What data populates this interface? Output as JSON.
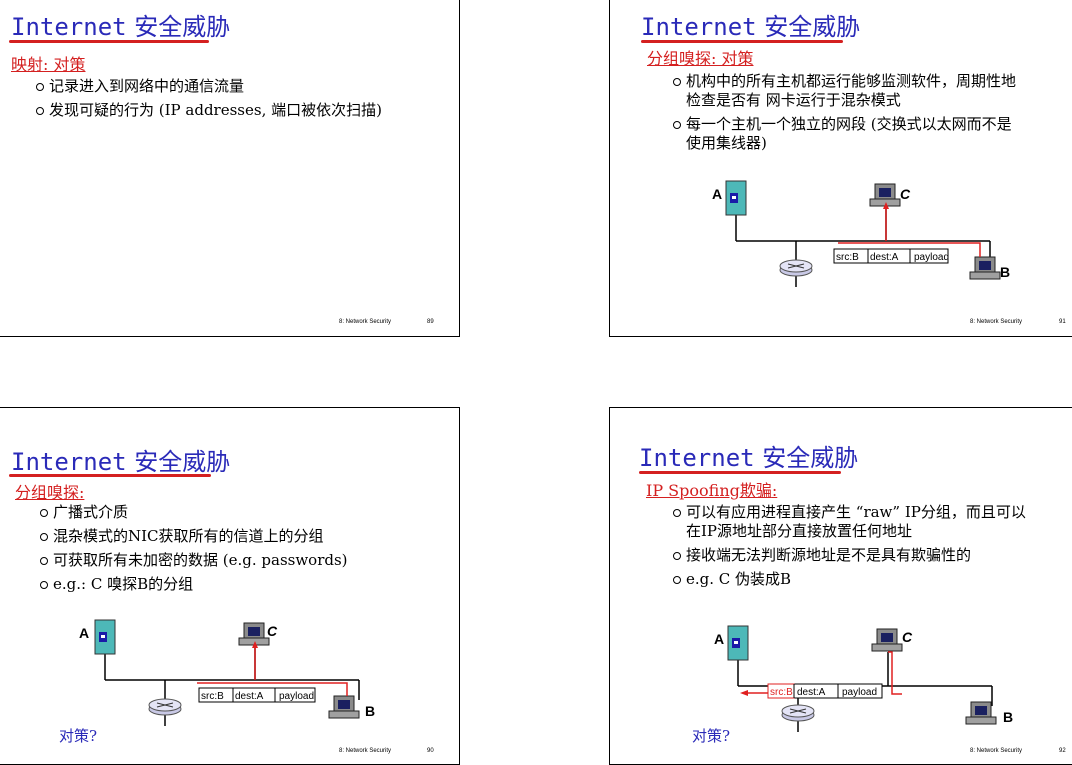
{
  "slides": {
    "s89": {
      "title_en": "Internet",
      "title_zh": " 安全威胁",
      "subtitle_a": "映射",
      "subtitle_b": ": 对策",
      "bullets": [
        "记录进入到网络中的通信流量",
        "发现可疑的行为 (IP addresses, 端口被依次扫描)"
      ],
      "footer": "8: Network Security",
      "page": "89"
    },
    "s91": {
      "title_en": "Internet",
      "title_zh": " 安全威胁",
      "subtitle_a": "分组嗅探",
      "subtitle_b": ": 对策",
      "bullets": [
        "机构中的所有主机都运行能够监测软件，周期性地",
        "检查是否有 网卡运行于混杂模式",
        "每一个主机一个独立的网段 (交换式以太网而不是",
        "使用集线器)"
      ],
      "diagram": {
        "host_a": "A",
        "host_b": "B",
        "host_c": "C",
        "packet_src": "src:B",
        "packet_dest": "dest:A",
        "packet_payload": "payload"
      },
      "footer": "8: Network Security",
      "page": "91"
    },
    "s90": {
      "title_en": "Internet",
      "title_zh": " 安全威胁",
      "subtitle_a": "分组嗅探",
      "subtitle_b": ":",
      "bullets": [
        "广播式介质",
        "混杂模式的NIC获取所有的信道上的分组",
        "可获取所有未加密的数据 (e.g. passwords)",
        "e.g.: C 嗅探B的分组"
      ],
      "diagram": {
        "host_a": "A",
        "host_b": "B",
        "host_c": "C",
        "packet_src": "src:B",
        "packet_dest": "dest:A",
        "packet_payload": "payload"
      },
      "countermeasure": "对策?",
      "footer": "8: Network Security",
      "page": "90"
    },
    "s92": {
      "title_en": "Internet",
      "title_zh": " 安全威胁",
      "subtitle_a": "IP Spoofing欺骗",
      "subtitle_b": ":",
      "bullets": [
        "可以有应用进程直接产生 “raw” IP分组，而且可以",
        "在IP源地址部分直接放置任何地址",
        "接收端无法判断源地址是不是具有欺骗性的",
        "e.g.  C 伪装成B"
      ],
      "diagram": {
        "host_a": "A",
        "host_b": "B",
        "host_c": "C",
        "packet_src": "src:B",
        "packet_dest": "dest:A",
        "packet_payload": "payload"
      },
      "countermeasure": "对策?",
      "footer": "8: Network Security",
      "page": "92"
    }
  }
}
